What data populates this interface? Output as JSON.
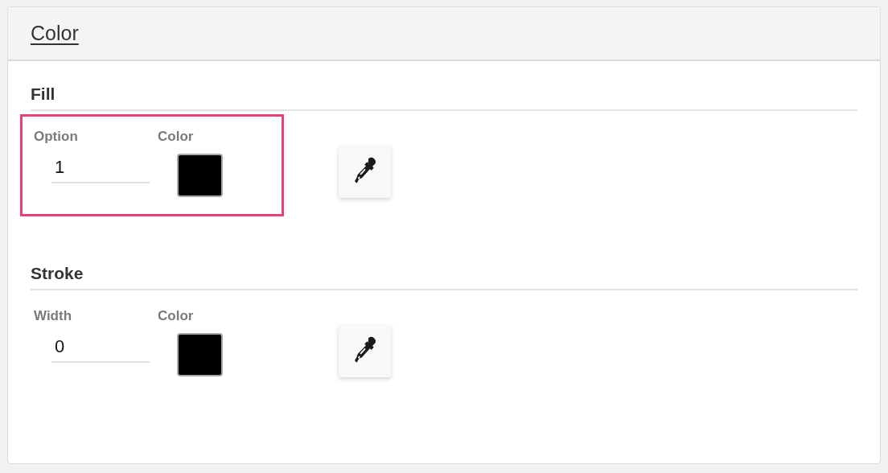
{
  "panel": {
    "title": "Color"
  },
  "sections": [
    {
      "heading": "Fill",
      "highlighted": true,
      "fields": [
        {
          "kind": "input",
          "label": "Option",
          "value": "1"
        },
        {
          "kind": "swatch",
          "label": "Color",
          "color": "#000000"
        }
      ]
    },
    {
      "heading": "Stroke",
      "highlighted": false,
      "fields": [
        {
          "kind": "input",
          "label": "Width",
          "value": "0"
        },
        {
          "kind": "swatch",
          "label": "Color",
          "color": "#000000"
        }
      ]
    }
  ]
}
